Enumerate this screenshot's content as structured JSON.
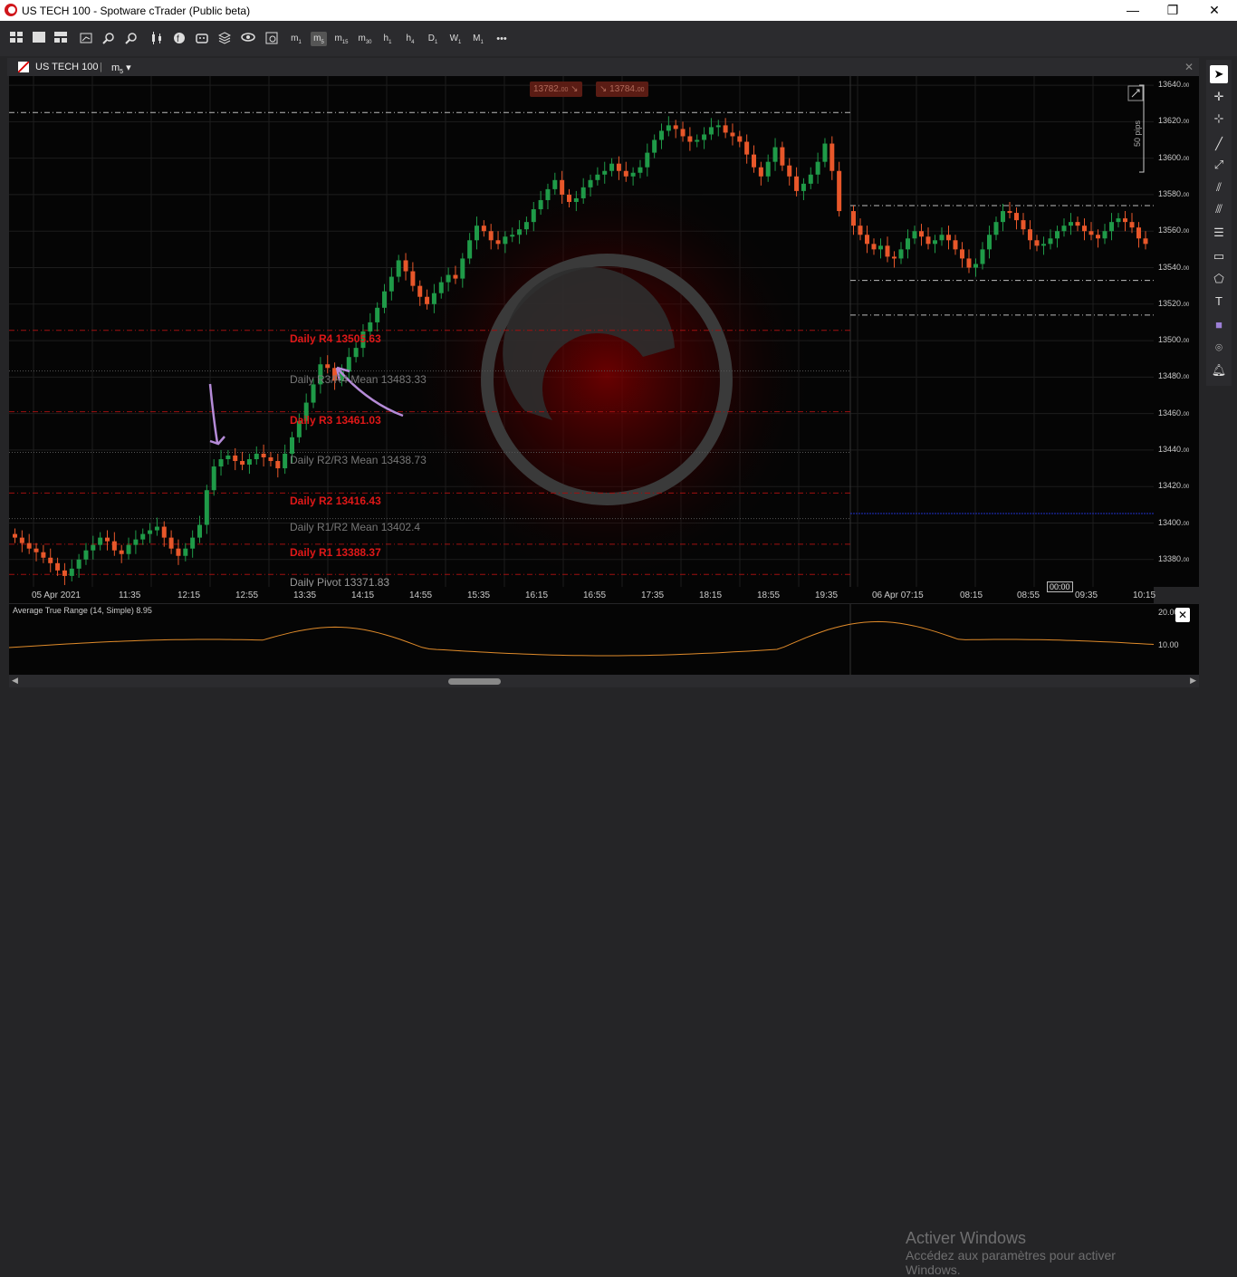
{
  "window": {
    "title": "US TECH 100 - Spotware cTrader (Public beta)",
    "min": "—",
    "max": "❐",
    "close": "✕"
  },
  "toolbar": {
    "timeframes": [
      {
        "base": "m",
        "sub": "1"
      },
      {
        "base": "m",
        "sub": "5"
      },
      {
        "base": "m",
        "sub": "15"
      },
      {
        "base": "m",
        "sub": "30"
      },
      {
        "base": "h",
        "sub": "1"
      },
      {
        "base": "h",
        "sub": "4"
      },
      {
        "base": "D",
        "sub": "1"
      },
      {
        "base": "W",
        "sub": "1"
      },
      {
        "base": "M",
        "sub": "1"
      }
    ],
    "more": "•••"
  },
  "tab": {
    "symbol": "US TECH 100",
    "timeframe_base": "m",
    "timeframe_sub": "5",
    "dropdown": "▾",
    "close": "✕"
  },
  "price_boxes": {
    "sell": "13782.",
    "sell_small": "00",
    "buy": "13784.",
    "buy_small": "00"
  },
  "pips_label": "50 pips",
  "pivots": [
    {
      "label": "Daily R4 13505.63",
      "value": 13505.63,
      "color": "#e01818"
    },
    {
      "label": "Daily R3/R4 Mean 13483.33",
      "value": 13483.33,
      "color": "#777777"
    },
    {
      "label": "Daily R3 13461.03",
      "value": 13461.03,
      "color": "#e01818"
    },
    {
      "label": "Daily R2/R3 Mean 13438.73",
      "value": 13438.73,
      "color": "#777777"
    },
    {
      "label": "Daily R2 13416.43",
      "value": 13416.43,
      "color": "#e01818"
    },
    {
      "label": "Daily R1/R2 Mean 13402.4",
      "value": 13402.4,
      "color": "#777777"
    },
    {
      "label": "Daily R1 13388.37",
      "value": 13388.37,
      "color": "#e01818"
    },
    {
      "label": "Daily Pivot 13371.83",
      "value": 13371.83,
      "color": "#999999"
    }
  ],
  "yaxis_labels": [
    {
      "v": 13640,
      "t": "13640."
    },
    {
      "v": 13620,
      "t": "13620."
    },
    {
      "v": 13600,
      "t": "13600."
    },
    {
      "v": 13580,
      "t": "13580."
    },
    {
      "v": 13560,
      "t": "13560."
    },
    {
      "v": 13540,
      "t": "13540."
    },
    {
      "v": 13520,
      "t": "13520."
    },
    {
      "v": 13500,
      "t": "13500."
    },
    {
      "v": 13480,
      "t": "13480."
    },
    {
      "v": 13460,
      "t": "13460."
    },
    {
      "v": 13440,
      "t": "13440."
    },
    {
      "v": 13420,
      "t": "13420."
    },
    {
      "v": 13400,
      "t": "13400."
    },
    {
      "v": 13380,
      "t": "13380."
    }
  ],
  "yaxis_small": "00",
  "xaxis_labels": [
    "05 Apr 2021",
    "11:35",
    "12:15",
    "12:55",
    "13:35",
    "14:15",
    "14:55",
    "15:35",
    "16:15",
    "16:55",
    "17:35",
    "18:15",
    "18:55",
    "19:35",
    "06 Apr 07:15",
    "08:15",
    "08:55",
    "09:35",
    "10:15"
  ],
  "countdown": "00:00",
  "atr": {
    "label": "Average True Range (14, Simple) 8.95",
    "y_labels": [
      "20.00",
      "10.00"
    ],
    "close": "✕"
  },
  "activation": {
    "title": "Activer Windows",
    "subtitle": "Accédez aux paramètres pour activer Windows."
  },
  "chart_data": {
    "type": "candlestick",
    "symbol": "US TECH 100",
    "timeframe": "m5",
    "ylim": [
      13365,
      13645
    ],
    "closes": [
      13392,
      13389,
      13386,
      13384,
      13381,
      13378,
      13374,
      13371,
      13375,
      13380,
      13385,
      13388,
      13392,
      13390,
      13385,
      13383,
      13388,
      13391,
      13394,
      13396,
      13398,
      13392,
      13386,
      13382,
      13386,
      13392,
      13399,
      13418,
      13431,
      13435,
      13437,
      13434,
      13432,
      13435,
      13438,
      13436,
      13434,
      13430,
      13438,
      13447,
      13456,
      13466,
      13476,
      13487,
      13485,
      13478,
      13483,
      13491,
      13496,
      13505,
      13510,
      13518,
      13527,
      13535,
      13544,
      13538,
      13530,
      13524,
      13520,
      13526,
      13532,
      13536,
      13534,
      13545,
      13555,
      13563,
      13560,
      13555,
      13553,
      13557,
      13558,
      13561,
      13565,
      13572,
      13577,
      13583,
      13588,
      13580,
      13576,
      13578,
      13584,
      13588,
      13591,
      13593,
      13597,
      13593,
      13590,
      13592,
      13595,
      13603,
      13610,
      13615,
      13618,
      13616,
      13612,
      13609,
      13610,
      13613,
      13617,
      13618,
      13614,
      13612,
      13609,
      13602,
      13595,
      13590,
      13598,
      13606,
      13596,
      13590,
      13582,
      13586,
      13591,
      13598,
      13608,
      13593,
      13571,
      13563,
      13558,
      13553,
      13550,
      13552,
      13546,
      13545,
      13550,
      13556,
      13560,
      13557,
      13553,
      13555,
      13558,
      13555,
      13550,
      13545,
      13540,
      13542,
      13550,
      13558,
      13565,
      13571,
      13570,
      13566,
      13561,
      13555,
      13552,
      13553,
      13556,
      13560,
      13563,
      13565,
      13563,
      13560,
      13558,
      13556,
      13560,
      13565,
      13567,
      13565,
      13562,
      13556,
      13553
    ]
  }
}
